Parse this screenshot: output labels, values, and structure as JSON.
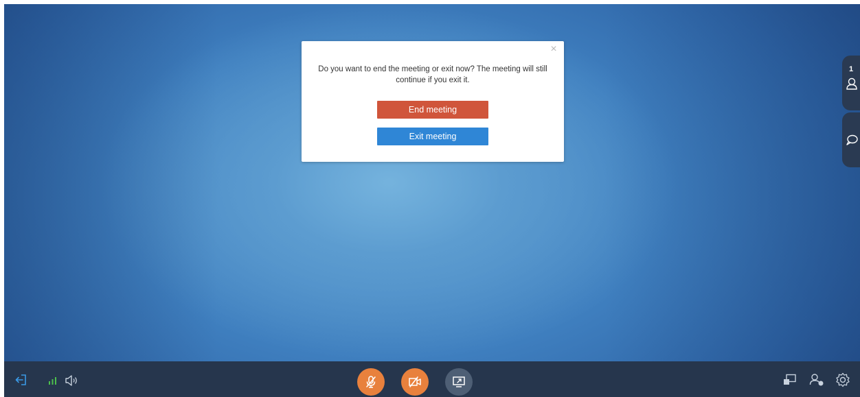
{
  "dialog": {
    "message": "Do you want to end the meeting or exit now? The meeting will still continue if you exit it.",
    "end_label": "End meeting",
    "exit_label": "Exit meeting",
    "close_glyph": "×",
    "end_color": "#d0553b",
    "exit_color": "#2f86d6"
  },
  "side_tabs": {
    "participants_count": "1",
    "participants_icon": "person-icon",
    "chat_icon": "chat-bubble-icon"
  },
  "toolbar": {
    "left_icons": [
      "exit-icon",
      "signal-strength-icon",
      "speaker-icon"
    ],
    "center_buttons": [
      {
        "name": "mic-muted-icon",
        "color": "#e8813d"
      },
      {
        "name": "video-off-icon",
        "color": "#e8813d"
      },
      {
        "name": "screen-share-icon",
        "color": "#4e5f75"
      }
    ],
    "right_icons": [
      "layout-icon",
      "participants-manage-icon",
      "settings-icon"
    ],
    "accent_color": "#e8813d",
    "bar_color": "#26364d"
  }
}
